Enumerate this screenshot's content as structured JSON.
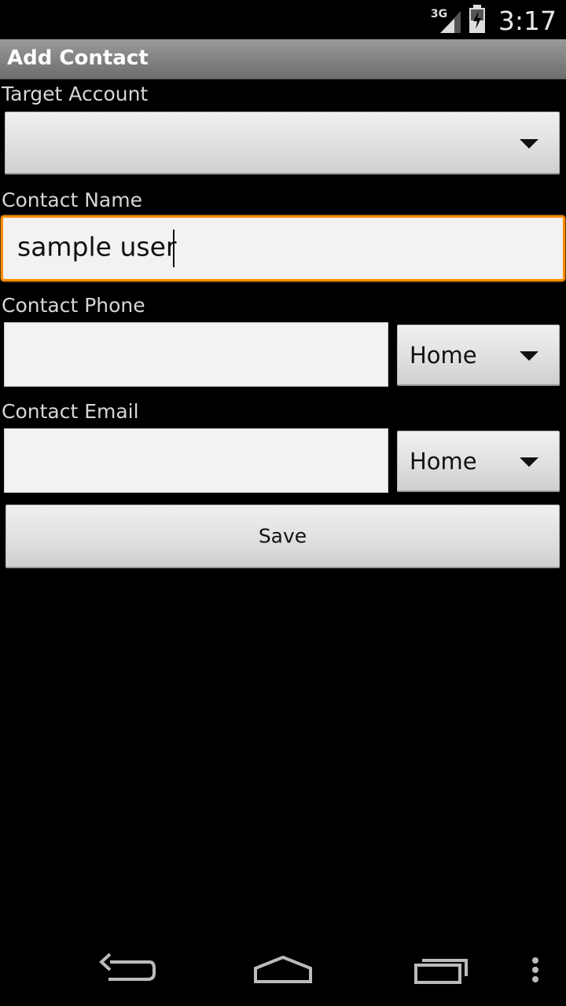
{
  "status_bar": {
    "network_type": "3G",
    "time": "3:17",
    "icons": [
      "signal-icon",
      "battery-charging-icon"
    ]
  },
  "action_bar": {
    "title": "Add Contact"
  },
  "form": {
    "target_account": {
      "label": "Target Account",
      "selected_value": ""
    },
    "contact_name": {
      "label": "Contact Name",
      "value": "sample user"
    },
    "contact_phone": {
      "label": "Contact Phone",
      "value": "",
      "type_selected": "Home"
    },
    "contact_email": {
      "label": "Contact Email",
      "value": "",
      "type_selected": "Home"
    },
    "save_label": "Save"
  },
  "nav_bar": {
    "icons": [
      "back-icon",
      "home-icon",
      "recent-apps-icon",
      "overflow-menu-icon"
    ]
  },
  "colors": {
    "focus_border": "#ff8c00",
    "background": "#000000",
    "action_bar": "#8a8a8a"
  }
}
